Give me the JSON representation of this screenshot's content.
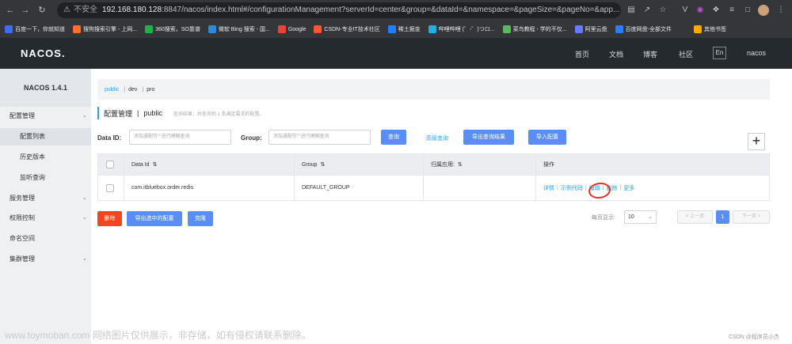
{
  "browser": {
    "url_security": "不安全",
    "url_host": "192.168.180.128",
    "url_rest": ":8847/nacos/index.html#/configurationManagement?serverId=center&group=&dataId=&namespace=&pageSize=&pageNo=&app...",
    "bookmarks": [
      {
        "label": "百度一下，你就知道",
        "color": "#3b6ef0"
      },
      {
        "label": "搜狗搜索引擎 - 上网...",
        "color": "#ff6d2e"
      },
      {
        "label": "360搜索，SO靠谱",
        "color": "#20b24a"
      },
      {
        "label": "微软 Bing 搜索 - 国...",
        "color": "#2c8ad9"
      },
      {
        "label": "Google",
        "color": "#ea4335"
      },
      {
        "label": "CSDN-专业IT技术社区",
        "color": "#fc5531"
      },
      {
        "label": "稀土掘金",
        "color": "#1e80ff"
      },
      {
        "label": "哔哩哔哩 (゜-゜)つロ...",
        "color": "#23ade5"
      },
      {
        "label": "菜鸟教程 - 学的不仅...",
        "color": "#5cb85c"
      },
      {
        "label": "阿里云盘",
        "color": "#637dff"
      },
      {
        "label": "百度网盘-全部文件",
        "color": "#2c7ef8"
      },
      {
        "label": "其他书签",
        "color": "#f9ab00"
      }
    ]
  },
  "topnav": {
    "logo": "NACOS.",
    "links": [
      "首页",
      "文档",
      "博客",
      "社区"
    ],
    "lang": "En",
    "user": "nacos"
  },
  "sidebar": {
    "version": "NACOS 1.4.1",
    "items": [
      {
        "label": "配置管理",
        "sub": false,
        "chev": true
      },
      {
        "label": "配置列表",
        "sub": true,
        "chev": false,
        "active": true
      },
      {
        "label": "历史版本",
        "sub": true,
        "chev": false
      },
      {
        "label": "监听查询",
        "sub": true,
        "chev": false
      },
      {
        "label": "服务管理",
        "sub": false,
        "chev": true
      },
      {
        "label": "权限控制",
        "sub": false,
        "chev": true
      },
      {
        "label": "命名空间",
        "sub": false,
        "chev": false
      },
      {
        "label": "集群管理",
        "sub": false,
        "chev": true
      }
    ]
  },
  "namespaces": [
    "public",
    "dev",
    "pro"
  ],
  "title": {
    "main": "配置管理",
    "sep": "|",
    "ns": "public",
    "hint": "查询结果：共查询到 1 条满足要求的配置。"
  },
  "filters": {
    "dataid_label": "Data ID:",
    "dataid_placeholder": "添加通配符'*'进行模糊查询",
    "group_label": "Group:",
    "group_placeholder": "添加通配符'*'进行模糊查询",
    "query": "查询",
    "advanced": "高级查询",
    "export_query": "导出查询结果",
    "import": "导入配置",
    "add": "+"
  },
  "table": {
    "headers": [
      "Data Id",
      "Group",
      "归属应用:",
      "操作"
    ],
    "rows": [
      {
        "dataid": "com.itbluebox.order.redis",
        "group": "DEFAULT_GROUP",
        "app": ""
      }
    ],
    "ops": [
      "详情",
      "示例代码",
      "编辑",
      "删除",
      "更多"
    ]
  },
  "bottom": {
    "delete": "删除",
    "export_selected": "导出选中的配置",
    "clone": "克隆",
    "page_size_label": "每页显示:",
    "page_size": "10",
    "prev": "< 上一页",
    "page": "1",
    "next": "下一页 >"
  },
  "watermark": "www.toymoban.com 网络图片仅供展示，非存储，如有侵权请联系删除。",
  "watermark2": "CSDN @程序员小杰"
}
